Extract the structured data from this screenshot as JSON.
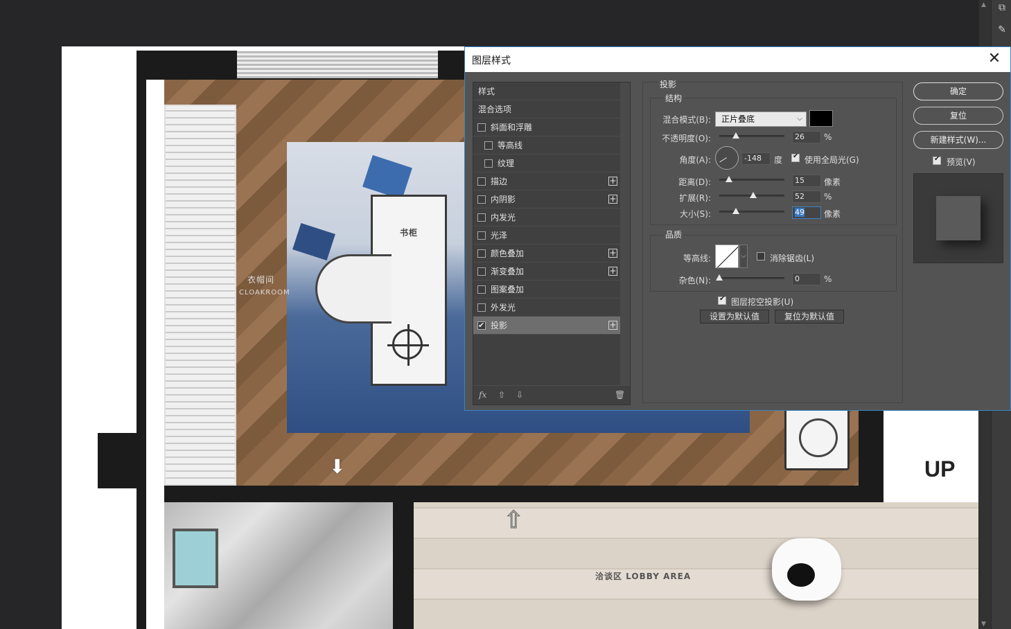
{
  "dialog": {
    "title": "图层样式",
    "close_glyph": "✕"
  },
  "style_list": {
    "headers": [
      "样式",
      "混合选项"
    ],
    "items": [
      {
        "label": "斜面和浮雕",
        "checked": false,
        "indent": false,
        "plus": false
      },
      {
        "label": "等高线",
        "checked": false,
        "indent": true,
        "plus": false
      },
      {
        "label": "纹理",
        "checked": false,
        "indent": true,
        "plus": false
      },
      {
        "label": "描边",
        "checked": false,
        "indent": false,
        "plus": true
      },
      {
        "label": "内阴影",
        "checked": false,
        "indent": false,
        "plus": true
      },
      {
        "label": "内发光",
        "checked": false,
        "indent": false,
        "plus": false
      },
      {
        "label": "光泽",
        "checked": false,
        "indent": false,
        "plus": false
      },
      {
        "label": "颜色叠加",
        "checked": false,
        "indent": false,
        "plus": true
      },
      {
        "label": "渐变叠加",
        "checked": false,
        "indent": false,
        "plus": true
      },
      {
        "label": "图案叠加",
        "checked": false,
        "indent": false,
        "plus": false
      },
      {
        "label": "外发光",
        "checked": false,
        "indent": false,
        "plus": false
      },
      {
        "label": "投影",
        "checked": true,
        "indent": false,
        "plus": true,
        "selected": true
      }
    ],
    "footer": {
      "fx": "fx",
      "up": "⇧",
      "down": "⇩",
      "trash": "🗑"
    }
  },
  "settings": {
    "section_title": "投影",
    "structure": {
      "title": "结构",
      "blend_mode_label": "混合模式(B):",
      "blend_mode_value": "正片叠底",
      "shadow_color": "#000000",
      "opacity_label": "不透明度(O):",
      "opacity_value": "26",
      "opacity_unit": "%",
      "opacity_fraction": 0.26,
      "angle_label": "角度(A):",
      "angle_value": "-148",
      "angle_unit": "度",
      "global_light_label": "使用全局光(G)",
      "global_light_checked": true,
      "distance_label": "距离(D):",
      "distance_value": "15",
      "distance_unit": "像素",
      "distance_fraction": 0.15,
      "spread_label": "扩展(R):",
      "spread_value": "52",
      "spread_unit": "%",
      "spread_fraction": 0.52,
      "size_label": "大小(S):",
      "size_value": "49",
      "size_unit": "像素",
      "size_fraction": 0.25
    },
    "quality": {
      "title": "品质",
      "contour_label": "等高线:",
      "antialias_label": "消除锯齿(L)",
      "antialias_checked": false,
      "noise_label": "杂色(N):",
      "noise_value": "0",
      "noise_unit": "%",
      "noise_fraction": 0.0
    },
    "knockout_label": "图层挖空投影(U)",
    "knockout_checked": true,
    "make_default_label": "设置为默认值",
    "reset_default_label": "复位为默认值"
  },
  "buttons": {
    "ok": "确定",
    "reset": "复位",
    "new_style": "新建样式(W)...",
    "preview_label": "预览(V)",
    "preview_checked": true
  },
  "canvas": {
    "room_label_1": "衣帽间",
    "room_label_1_en": "CLOAKROOM",
    "furniture_label": "书柜",
    "lobby_label": "洽谈区 LOBBY AREA",
    "up_label": "UP"
  }
}
